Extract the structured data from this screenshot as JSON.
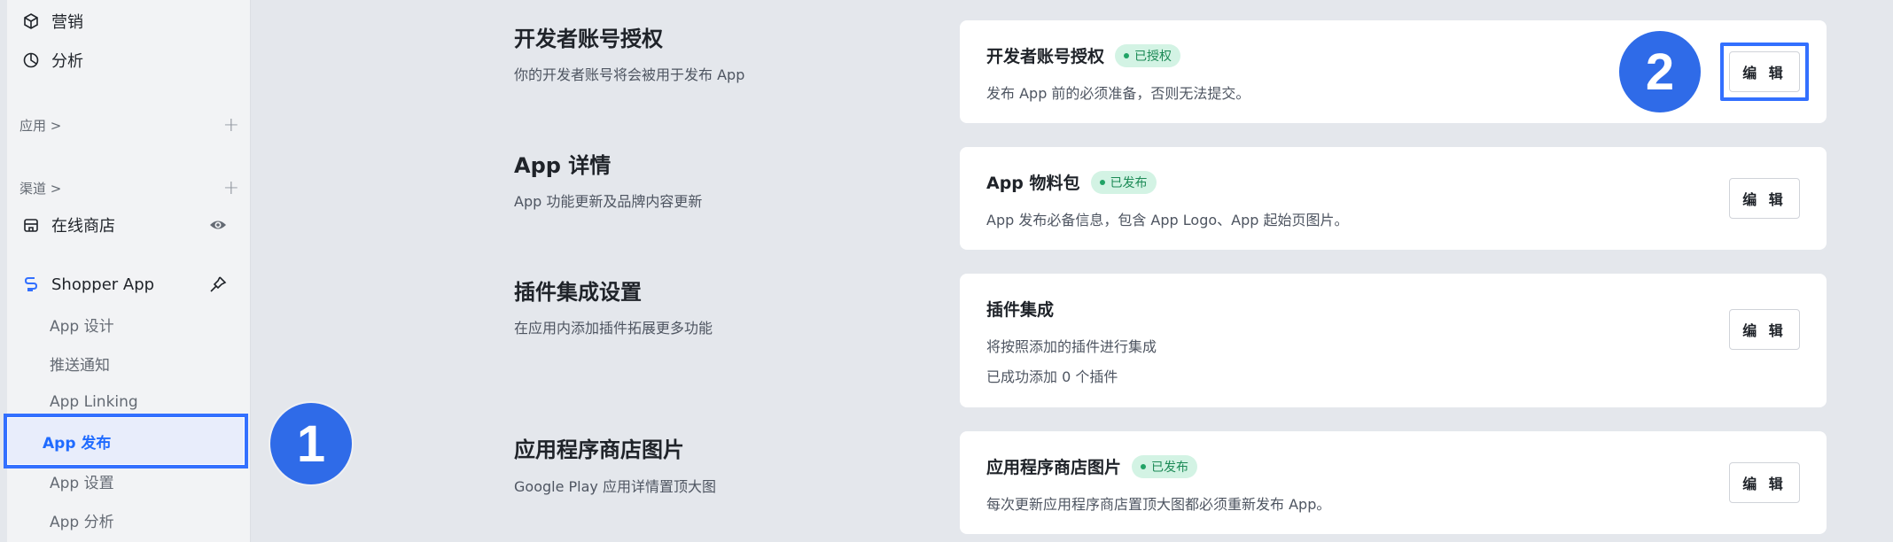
{
  "sidebar": {
    "top_items": [
      {
        "label": "营销",
        "icon": "cube-icon"
      },
      {
        "label": "分析",
        "icon": "pie-chart-icon"
      }
    ],
    "sections": [
      {
        "label": "应用 >",
        "add": "+"
      },
      {
        "label": "渠道 >",
        "add": "+"
      }
    ],
    "online_store": {
      "label": "在线商店",
      "icon": "store-icon",
      "action_icon": "eye-icon"
    },
    "shopper_app": {
      "label": "Shopper App",
      "icon": "app-logo-icon",
      "action_icon": "pin-icon"
    },
    "sub_items": [
      {
        "label": "App 设计"
      },
      {
        "label": "推送通知"
      },
      {
        "label": "App Linking"
      },
      {
        "label": "App 发布",
        "active": true
      },
      {
        "label": "App 设置"
      },
      {
        "label": "App 分析"
      }
    ]
  },
  "annotations": {
    "step1": "1",
    "step2": "2"
  },
  "sections": [
    {
      "title": "开发者账号授权",
      "desc": "你的开发者账号将会被用于发布 App",
      "card_title": "开发者账号授权",
      "badge": "已授权",
      "lines": [
        "发布 App 前的必须准备，否则无法提交。"
      ],
      "button": "编 辑"
    },
    {
      "title": "App 详情",
      "desc": "App 功能更新及品牌内容更新",
      "card_title": "App 物料包",
      "badge": "已发布",
      "lines": [
        "App 发布必备信息，包含 App Logo、App 起始页图片。"
      ],
      "button": "编 辑"
    },
    {
      "title": "插件集成设置",
      "desc": "在应用内添加插件拓展更多功能",
      "card_title": "插件集成",
      "badge": "",
      "lines": [
        "将按照添加的插件进行集成",
        "已成功添加 0 个插件"
      ],
      "button": "编 辑"
    },
    {
      "title": "应用程序商店图片",
      "desc": "Google Play 应用详情置顶大图",
      "card_title": "应用程序商店图片",
      "badge": "已发布",
      "lines": [
        "每次更新应用程序商店置顶大图都必须重新发布 App。"
      ],
      "button": "编 辑"
    }
  ],
  "colors": {
    "accent": "#3370ff",
    "badge_bg": "#d3f3e4",
    "badge_text": "#1c8a56"
  }
}
